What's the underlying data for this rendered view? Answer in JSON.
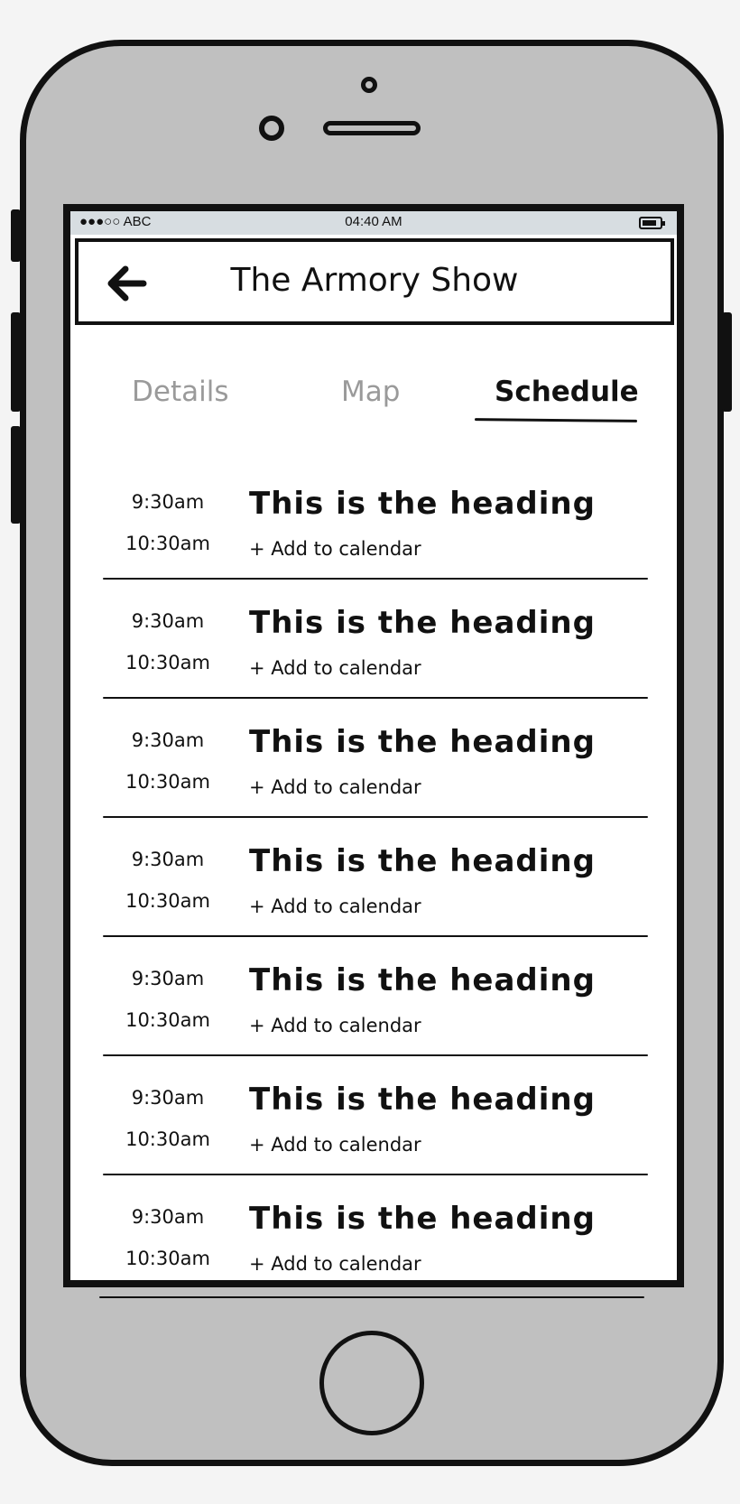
{
  "status_bar": {
    "carrier": "●●●○○ ABC",
    "time": "04:40 AM"
  },
  "nav": {
    "title": "The Armory Show"
  },
  "tabs": [
    {
      "label": "Details",
      "active": false
    },
    {
      "label": "Map",
      "active": false
    },
    {
      "label": "Schedule",
      "active": true
    }
  ],
  "schedule": [
    {
      "start": "9:30am",
      "end": "10:30am",
      "heading": "This is the heading",
      "action": "+ Add to calendar"
    },
    {
      "start": "9:30am",
      "end": "10:30am",
      "heading": "This is the heading",
      "action": "+ Add to calendar"
    },
    {
      "start": "9:30am",
      "end": "10:30am",
      "heading": "This is the heading",
      "action": "+ Add to calendar"
    },
    {
      "start": "9:30am",
      "end": "10:30am",
      "heading": "This is the heading",
      "action": "+ Add to calendar"
    },
    {
      "start": "9:30am",
      "end": "10:30am",
      "heading": "This is the heading",
      "action": "+ Add to calendar"
    },
    {
      "start": "9:30am",
      "end": "10:30am",
      "heading": "This is the heading",
      "action": "+ Add to calendar"
    },
    {
      "start": "9:30am",
      "end": "10:30am",
      "heading": "This is the heading",
      "action": "+ Add to calendar"
    }
  ],
  "colors": {
    "device": "#c0c0c0",
    "outline": "#111111",
    "status_bar": "#d7dde1",
    "inactive_tab": "#9a9a9a"
  },
  "icons": {
    "back": "left-arrow-icon",
    "battery": "battery-icon"
  }
}
